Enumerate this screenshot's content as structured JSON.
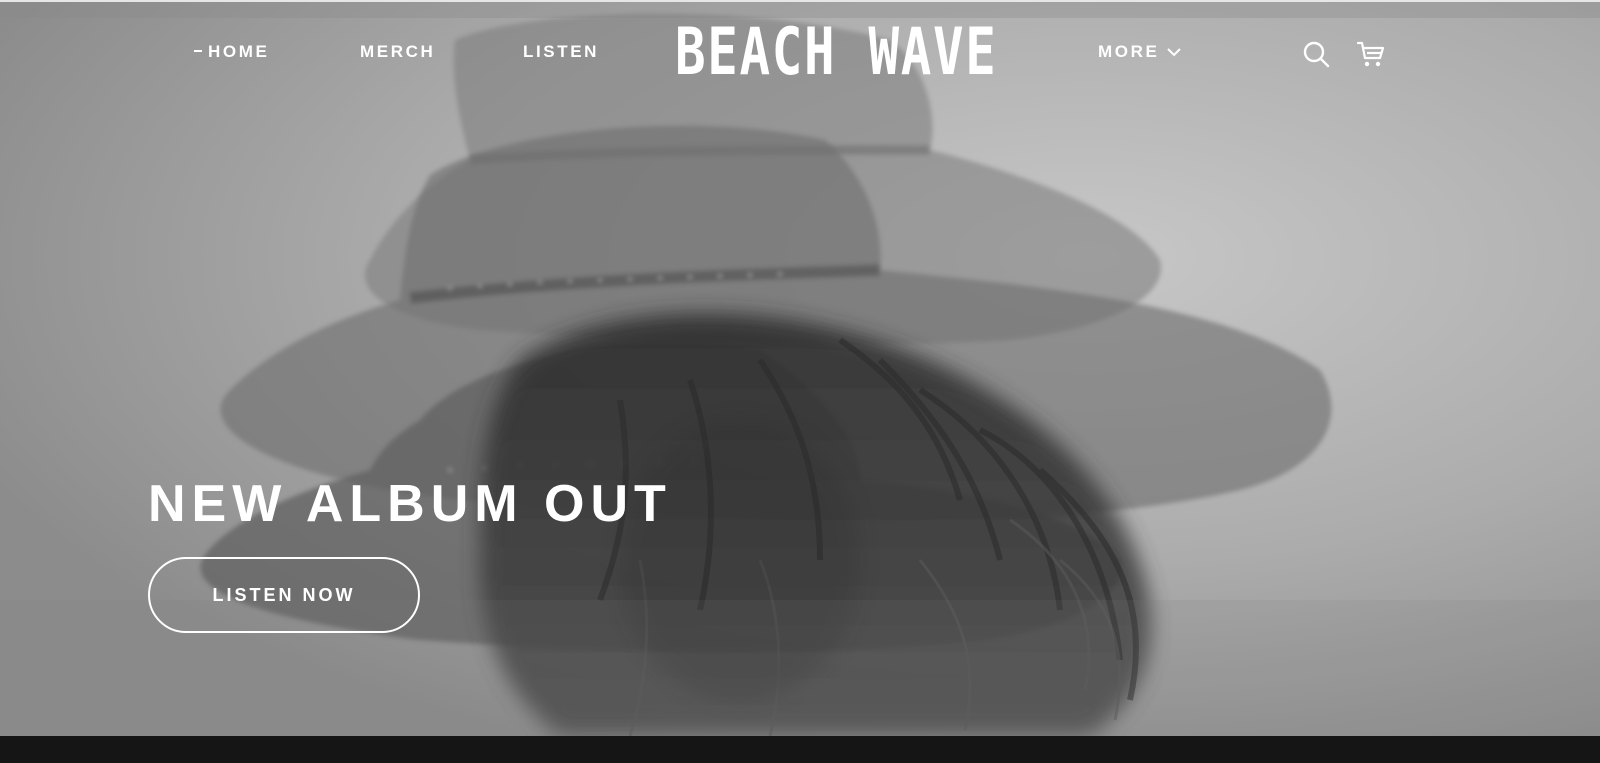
{
  "brand": {
    "logo_text": "BEACH WAVE"
  },
  "nav": {
    "home_label": "HOME",
    "merch_label": "MERCH",
    "listen_label": "LISTEN",
    "more_label": "MORE",
    "active_item": "HOME"
  },
  "icons": {
    "search": "search-icon",
    "cart": "cart-icon",
    "more_dropdown": "chevron-down-icon"
  },
  "hero": {
    "headline": "NEW ALBUM OUT",
    "cta_label": "LISTEN NOW",
    "image_description_tag": "hero-image"
  },
  "colors": {
    "text": "#ffffff",
    "footer_bar": "#151515"
  }
}
